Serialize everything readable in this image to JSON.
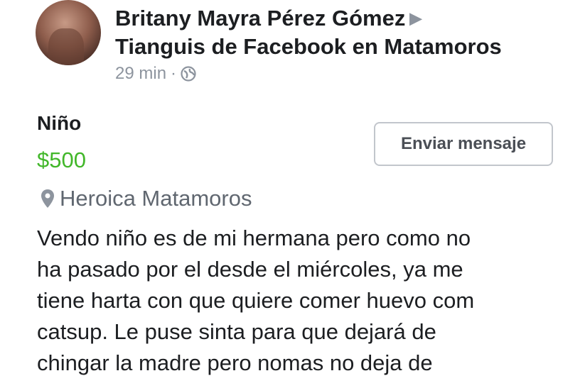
{
  "post": {
    "author": "Britany Mayra Pérez Gómez",
    "group": "Tianguis de Facebook en Matamoros",
    "time": "29 min",
    "separator": "·",
    "privacy_icon": "globe-icon",
    "arrow_icon": "right-triangle-icon"
  },
  "listing": {
    "title": "Niño",
    "price": "$500",
    "location": "Heroica Matamoros",
    "location_icon": "map-pin-icon",
    "message_button": "Enviar mensaje",
    "description": "Vendo niño es de mi hermana pero como no\nha pasado por el desde el miércoles, ya me\ntiene harta con que quiere comer huevo com\ncatsup. Le puse sinta para que dejará de\nchingar la madre pero nomas no deja de"
  },
  "colors": {
    "price": "#42b72a",
    "muted": "#8d949e",
    "text": "#1c1e21"
  }
}
